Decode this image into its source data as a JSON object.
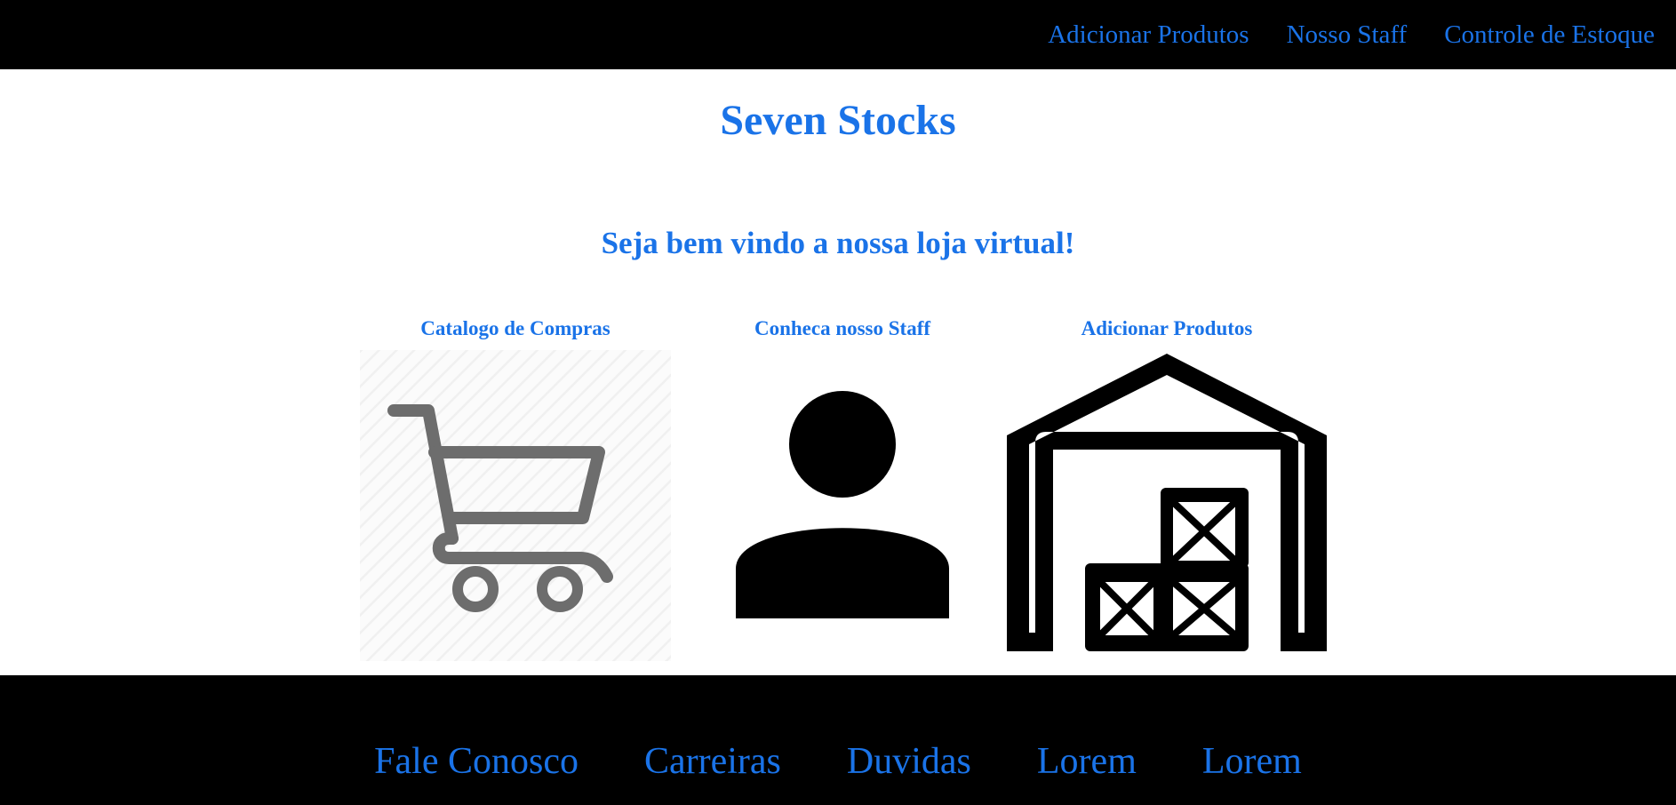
{
  "header": {
    "nav": [
      {
        "label": "Adicionar Produtos"
      },
      {
        "label": "Nosso Staff"
      },
      {
        "label": "Controle de Estoque"
      }
    ]
  },
  "main": {
    "title": "Seven Stocks",
    "welcome": "Seja bem vindo a nossa loja virtual!",
    "cards": [
      {
        "title": "Catalogo de Compras",
        "icon": "shopping-cart-icon"
      },
      {
        "title": "Conheca nosso Staff",
        "icon": "person-icon"
      },
      {
        "title": "Adicionar Produtos",
        "icon": "warehouse-icon"
      }
    ]
  },
  "footer": {
    "links": [
      {
        "label": "Fale Conosco"
      },
      {
        "label": "Carreiras"
      },
      {
        "label": "Duvidas"
      },
      {
        "label": "Lorem"
      },
      {
        "label": "Lorem"
      }
    ]
  },
  "colors": {
    "accent": "#1a73e8",
    "bar_background": "#000000",
    "page_background": "#ffffff",
    "cart_icon": "#6d6d6d",
    "icon_dark": "#000000"
  }
}
